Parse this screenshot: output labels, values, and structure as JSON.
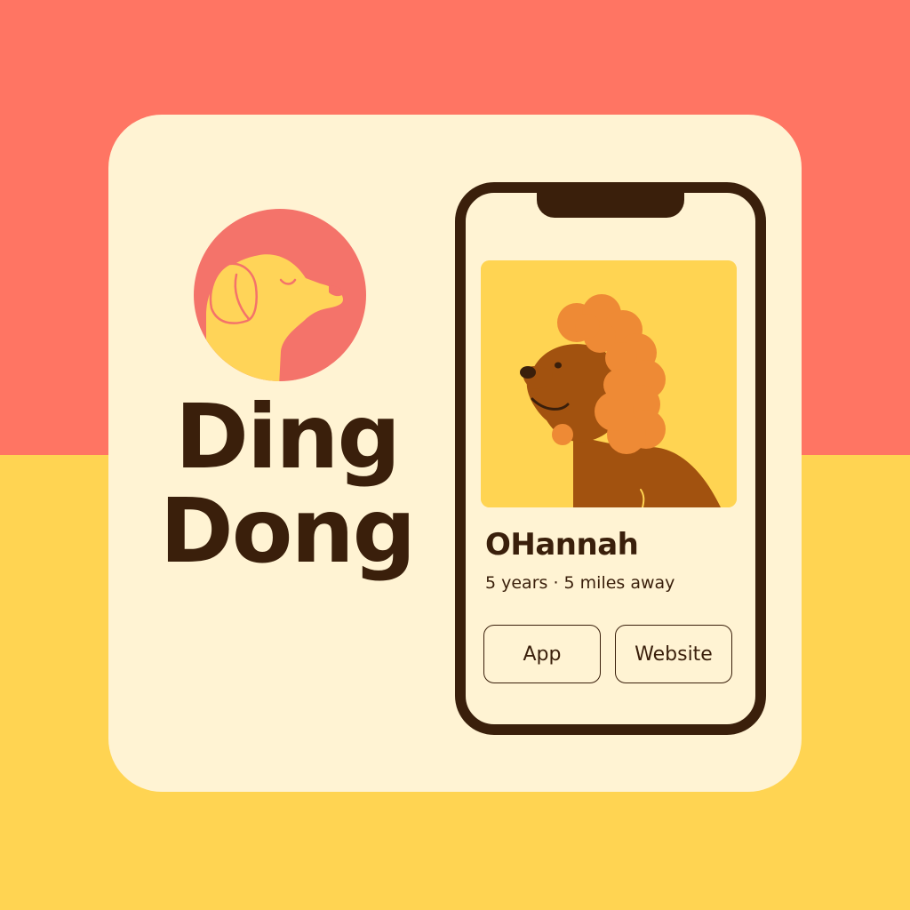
{
  "brand": {
    "line1": "Ding",
    "line2": "Dong",
    "logo_icon": "dog-head-icon"
  },
  "colors": {
    "top_background": "#FF7563",
    "bottom_background": "#FFD452",
    "card": "#FFF3D3",
    "ink": "#3A1F0B",
    "photo_background": "#FFD452",
    "dog_fur": "#A2520F",
    "dog_curls": "#EE8A35"
  },
  "profile": {
    "name": "OHannah",
    "meta": "5 years · 5 miles away",
    "photo_icon": "poodle-photo"
  },
  "buttons": {
    "app_label": "App",
    "website_label": "Website"
  }
}
